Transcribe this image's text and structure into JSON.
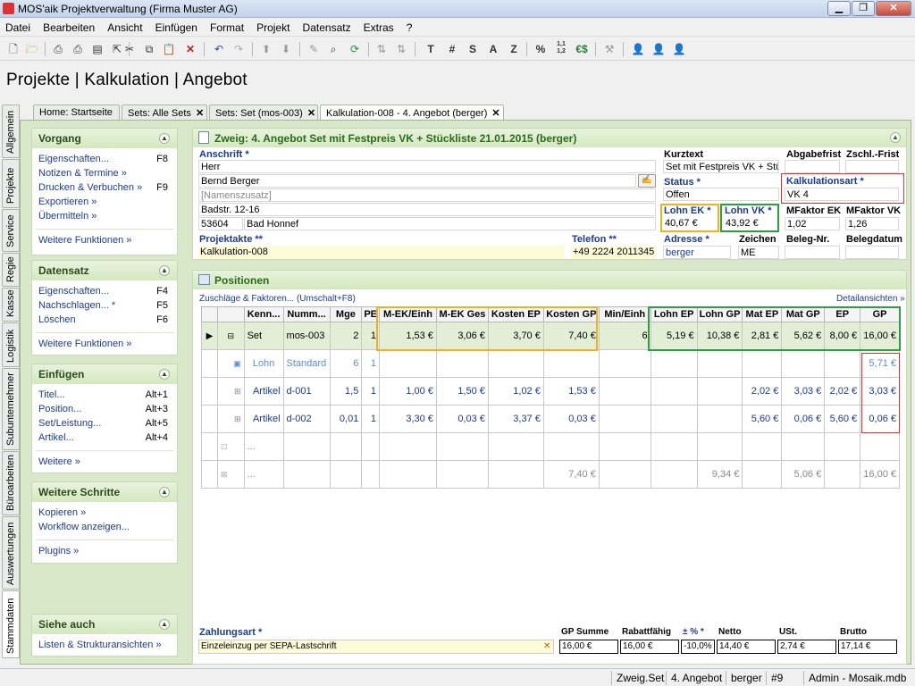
{
  "window": {
    "title": "MOS'aik Projektverwaltung (Firma Muster AG)"
  },
  "menu": [
    "Datei",
    "Bearbeiten",
    "Ansicht",
    "Einfügen",
    "Format",
    "Projekt",
    "Datensatz",
    "Extras",
    "?"
  ],
  "toolbar_text": {
    "t": "T",
    "hash": "#",
    "s": "S",
    "a": "A",
    "z": "Z",
    "percent": "%",
    "num": "1,1\n1,2",
    "euro": "€$"
  },
  "page_title": "Projekte | Kalkulation | Angebot",
  "tabs": [
    {
      "label": "Home: Startseite"
    },
    {
      "label": "Sets: Alle Sets"
    },
    {
      "label": "Sets: Set (mos-003)"
    },
    {
      "label": "Kalkulation-008 - 4. Angebot (berger)"
    }
  ],
  "vertical_tabs": [
    "Allgemein",
    "Projekte",
    "Service",
    "Regie",
    "Kasse",
    "Logistik",
    "Subunternehmer",
    "Büroarbeiten",
    "Auswertungen",
    "Stammdaten"
  ],
  "sidebar": {
    "vorgang": {
      "title": "Vorgang",
      "items": [
        {
          "label": "Eigenschaften...",
          "key": "F8"
        },
        {
          "label": "Notizen & Termine »",
          "key": ""
        },
        {
          "label": "Drucken & Verbuchen »",
          "key": "F9"
        },
        {
          "label": "Exportieren »",
          "key": ""
        },
        {
          "label": "Übermitteln »",
          "key": ""
        }
      ],
      "more": "Weitere Funktionen »"
    },
    "datensatz": {
      "title": "Datensatz",
      "items": [
        {
          "label": "Eigenschaften...",
          "key": "F4"
        },
        {
          "label": "Nachschlagen... *",
          "key": "F5"
        },
        {
          "label": "Löschen",
          "key": "F6"
        }
      ],
      "more": "Weitere Funktionen »"
    },
    "einfuegen": {
      "title": "Einfügen",
      "items": [
        {
          "label": "Titel...",
          "key": "Alt+1"
        },
        {
          "label": "Position...",
          "key": "Alt+3"
        },
        {
          "label": "Set/Leistung...",
          "key": "Alt+5"
        },
        {
          "label": "Artikel...",
          "key": "Alt+4"
        }
      ],
      "more": "Weitere »"
    },
    "weitere": {
      "title": "Weitere Schritte",
      "items": [
        {
          "label": "Kopieren »",
          "key": ""
        },
        {
          "label": "Workflow anzeigen...",
          "key": ""
        }
      ],
      "more": "Plugins »"
    },
    "siehe": {
      "title": "Siehe auch",
      "items": [
        {
          "label": "Listen & Strukturansichten »",
          "key": ""
        }
      ]
    }
  },
  "zweig": {
    "title": "Zweig: 4. Angebot Set mit Festpreis VK + Stückliste 21.01.2015 (berger)",
    "anschrift_label": "Anschrift *",
    "anrede": "Herr",
    "name": "Bernd Berger",
    "namenszusatz_placeholder": "[Namenszusatz]",
    "strasse": "Badstr. 12-16",
    "plz": "53604",
    "ort": "Bad Honnef",
    "projektakte_label": "Projektakte **",
    "projektakte": "Kalkulation-008",
    "telefon_label": "Telefon **",
    "telefon": "+49 2224 2011345",
    "kurztext_label": "Kurztext",
    "kurztext": "Set mit Festpreis VK + Stückliste",
    "abgabefrist_label": "Abgabefrist",
    "zschl_frist_label": "Zschl.-Frist",
    "status_label": "Status *",
    "status": "Offen",
    "kalkulationsart_label": "Kalkulationsart *",
    "kalkulationsart": "VK 4",
    "lohn_ek_label": "Lohn EK *",
    "lohn_ek": "40,67 €",
    "lohn_vk_label": "Lohn VK *",
    "lohn_vk": "43,92 €",
    "mfaktor_ek_label": "MFaktor EK",
    "mfaktor_ek": "1,02",
    "mfaktor_vk_label": "MFaktor VK",
    "mfaktor_vk": "1,26",
    "adresse_label": "Adresse *",
    "adresse": "berger",
    "zeichen_label": "Zeichen",
    "zeichen": "ME",
    "beleg_nr_label": "Beleg-Nr.",
    "belegdatum_label": "Belegdatum"
  },
  "positions": {
    "title": "Positionen",
    "zuschlaege": "Zuschläge & Faktoren... (Umschalt+F8)",
    "detail": "Detailansichten »",
    "columns": [
      "Kenn...",
      "Numm...",
      "Mge",
      "PE",
      "M-EK/Einh",
      "M-EK Ges",
      "Kosten EP",
      "Kosten GP",
      "Min/Einh",
      "Lohn EP",
      "Lohn GP",
      "Mat EP",
      "Mat GP",
      "EP",
      "GP"
    ],
    "rows": [
      {
        "kenn": "Set",
        "numm": "mos-003",
        "mge": "2",
        "pe": "1",
        "mek_einh": "1,53 €",
        "mek_ges": "3,06 €",
        "kosten_ep": "3,70 €",
        "kosten_gp": "7,40 €",
        "min_einh": "6",
        "lohn_ep": "5,19 €",
        "lohn_gp": "10,38 €",
        "mat_ep": "2,81 €",
        "mat_gp": "5,62 €",
        "ep": "8,00 €",
        "gp": "16,00 €"
      },
      {
        "kenn": "Lohn",
        "numm": "Standard",
        "mge": "6",
        "pe": "1",
        "mek_einh": "",
        "mek_ges": "",
        "kosten_ep": "",
        "kosten_gp": "",
        "min_einh": "",
        "lohn_ep": "",
        "lohn_gp": "",
        "mat_ep": "",
        "mat_gp": "",
        "ep": "",
        "gp": "5,71 €"
      },
      {
        "kenn": "Artikel",
        "numm": "d-001",
        "mge": "1,5",
        "pe": "1",
        "mek_einh": "1,00 €",
        "mek_ges": "1,50 €",
        "kosten_ep": "1,02 €",
        "kosten_gp": "1,53 €",
        "min_einh": "",
        "lohn_ep": "",
        "lohn_gp": "",
        "mat_ep": "2,02 €",
        "mat_gp": "3,03 €",
        "ep": "2,02 €",
        "gp": "3,03 €"
      },
      {
        "kenn": "Artikel",
        "numm": "d-002",
        "mge": "0,01",
        "pe": "1",
        "mek_einh": "3,30 €",
        "mek_ges": "0,03 €",
        "kosten_ep": "3,37 €",
        "kosten_gp": "0,03 €",
        "min_einh": "",
        "lohn_ep": "",
        "lohn_gp": "",
        "mat_ep": "5,60 €",
        "mat_gp": "0,06 €",
        "ep": "5,60 €",
        "gp": "0,06 €"
      },
      {
        "kenn": "...",
        "numm": "",
        "mge": "",
        "pe": "",
        "mek_einh": "",
        "mek_ges": "",
        "kosten_ep": "",
        "kosten_gp": "",
        "min_einh": "",
        "lohn_ep": "",
        "lohn_gp": "",
        "mat_ep": "",
        "mat_gp": "",
        "ep": "",
        "gp": ""
      },
      {
        "kenn": "...",
        "numm": "",
        "mge": "",
        "pe": "",
        "mek_einh": "",
        "mek_ges": "",
        "kosten_ep": "",
        "kosten_gp": "7,40 €",
        "min_einh": "",
        "lohn_ep": "",
        "lohn_gp": "9,34 €",
        "mat_ep": "",
        "mat_gp": "5,06 €",
        "ep": "",
        "gp": "16,00 €"
      }
    ]
  },
  "summary": {
    "zahlungsart_label": "Zahlungsart *",
    "zahlungsart": "Einzeleinzug per SEPA-Lastschrift",
    "gp_summe_label": "GP Summe",
    "gp_summe": "16,00 €",
    "rabattfaehig_label": "Rabattfähig",
    "rabattfaehig": "16,00 €",
    "prozent_label": "± % *",
    "prozent": "-10,0%",
    "netto_label": "Netto",
    "netto": "14,40 €",
    "ust_label": "USt.",
    "ust": "2,74 €",
    "brutto_label": "Brutto",
    "brutto": "17,14 €"
  },
  "statusbar": [
    "Zweig.Set",
    "4. Angebot",
    "berger",
    "#9",
    "Admin - Mosaik.mdb"
  ]
}
